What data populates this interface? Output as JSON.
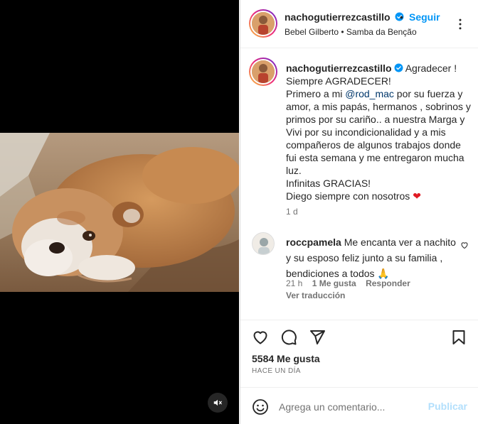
{
  "post": {
    "username": "nachogutierrezcastillo",
    "separator": "•",
    "follow_label": "Seguir",
    "audio": "Bebel Gilberto • Samba da Benção"
  },
  "caption": {
    "username": "nachogutierrezcastillo",
    "part1": "Agradecer !\nSiempre AGRADECER!\nPrimero a mi ",
    "mention": "@rod_mac",
    "part2": " por su fuerza y amor, a mis papás, hermanos , sobrinos y primos por su cariño.. a nuestra Marga y Vivi por su incondicionalidad y a mis compañeros de algunos trabajos donde fui esta semana y me entregaron mucha luz.\nInfinitas GRACIAS!\nDiego siempre con nosotros ",
    "emoji": "❤",
    "time": "1 d"
  },
  "comment": {
    "username": "roccpamela",
    "text": "Me encanta ver a nachito y su esposo feliz junto a su familia , bendiciones a todos 🙏",
    "time": "21 h",
    "likes": "1 Me gusta",
    "reply_label": "Responder",
    "translate_label": "Ver traducción"
  },
  "actions": {
    "likes": "5584 Me gusta",
    "date": "HACE UN DÍA"
  },
  "composer": {
    "placeholder": "Agrega un comentario...",
    "publish_label": "Publicar"
  },
  "colors": {
    "accent": "#0095f6",
    "verified": "#0095f6",
    "publish_disabled": "#b2dffc",
    "secondary_text": "#737373"
  },
  "icons": [
    "verified-icon",
    "more-options-icon",
    "heart-icon",
    "comment-icon",
    "share-icon",
    "save-icon",
    "emoji-icon",
    "mute-icon"
  ]
}
